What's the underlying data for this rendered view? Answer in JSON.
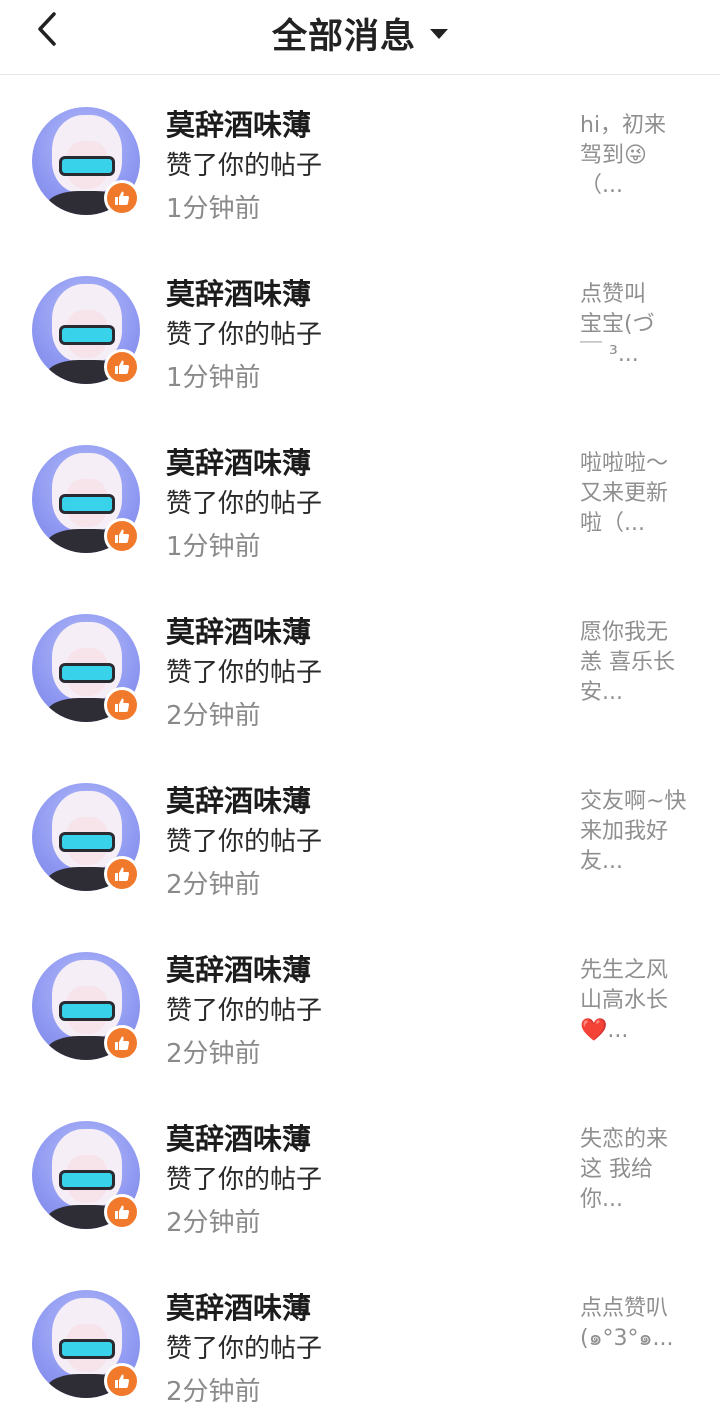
{
  "header": {
    "title": "全部消息",
    "back_icon": "chevron-left-icon",
    "dropdown_icon": "caret-down-icon"
  },
  "colors": {
    "like_badge": "#f0792c",
    "avatar_bg": "#8e98f1",
    "muted_text": "#8a8a8a"
  },
  "messages": [
    {
      "name": "莫辞酒味薄",
      "action": "赞了你的帖子",
      "time": "1分钟前",
      "preview": "hi，初来\n驾到😜\n（..."
    },
    {
      "name": "莫辞酒味薄",
      "action": "赞了你的帖子",
      "time": "1分钟前",
      "preview": "点赞叫\n宝宝(づ\n￣ ³..."
    },
    {
      "name": "莫辞酒味薄",
      "action": "赞了你的帖子",
      "time": "1分钟前",
      "preview": "啦啦啦～\n又来更新\n啦（..."
    },
    {
      "name": "莫辞酒味薄",
      "action": "赞了你的帖子",
      "time": "2分钟前",
      "preview": "愿你我无\n恙 喜乐长\n安..."
    },
    {
      "name": "莫辞酒味薄",
      "action": "赞了你的帖子",
      "time": "2分钟前",
      "preview": "交友啊~快\n来加我好\n友..."
    },
    {
      "name": "莫辞酒味薄",
      "action": "赞了你的帖子",
      "time": "2分钟前",
      "preview": "先生之风\n山高水长\n❤️..."
    },
    {
      "name": "莫辞酒味薄",
      "action": "赞了你的帖子",
      "time": "2分钟前",
      "preview": "失恋的来\n这  我给\n你..."
    },
    {
      "name": "莫辞酒味薄",
      "action": "赞了你的帖子",
      "time": "2分钟前",
      "preview": "点点赞叭\n(๑°3°๑..."
    }
  ]
}
